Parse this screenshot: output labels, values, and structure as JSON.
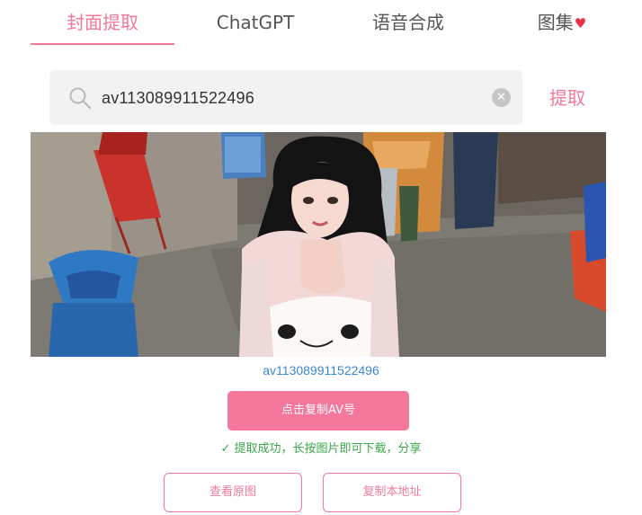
{
  "tabs": [
    {
      "label": "封面提取",
      "active": true
    },
    {
      "label": "ChatGPT",
      "active": false
    },
    {
      "label": "语音合成",
      "active": false
    },
    {
      "label": "图集",
      "active": false,
      "icon": "heart-icon"
    }
  ],
  "colors": {
    "accent": "#f17a99",
    "button": "#f5779b",
    "link": "#3a87d6",
    "success": "#3aa84a",
    "heart": "#e8334a"
  },
  "search": {
    "value": "av113089911522496",
    "icon": "search-icon",
    "clear_icon": "clear-icon",
    "action_label": "提取"
  },
  "result": {
    "av_id": "av113089911522496",
    "copy_button_label": "点击复制AV号",
    "status_icon": "check-icon",
    "status_symbol": "✓",
    "status_text": "提取成功，长按图片即可下载，分享",
    "view_original_label": "查看原图",
    "copy_url_label": "复制本地址"
  }
}
